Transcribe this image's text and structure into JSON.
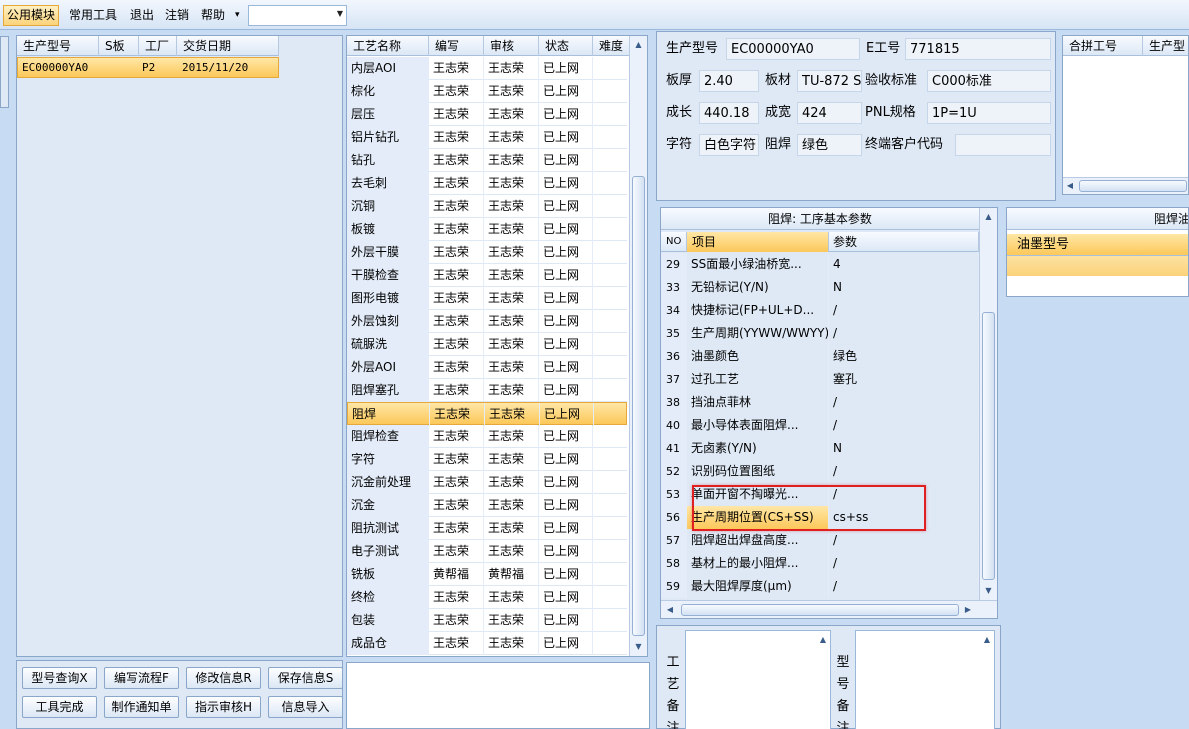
{
  "menubar": {
    "items": [
      "公用模块",
      "常用工具",
      "退出",
      "注销",
      "帮助"
    ],
    "combo_value": ""
  },
  "product_grid": {
    "headers": [
      "生产型号",
      "S板",
      "工厂",
      "交货日期"
    ],
    "rows": [
      [
        "EC00000YA0",
        "",
        "P2",
        "2015/11/20"
      ]
    ]
  },
  "process_grid": {
    "headers": [
      "工艺名称",
      "编写",
      "审核",
      "状态",
      "难度"
    ],
    "rows": [
      [
        "内层AOI",
        "王志荣",
        "王志荣",
        "已上网",
        ""
      ],
      [
        "棕化",
        "王志荣",
        "王志荣",
        "已上网",
        ""
      ],
      [
        "层压",
        "王志荣",
        "王志荣",
        "已上网",
        ""
      ],
      [
        "铝片钻孔",
        "王志荣",
        "王志荣",
        "已上网",
        ""
      ],
      [
        "钻孔",
        "王志荣",
        "王志荣",
        "已上网",
        ""
      ],
      [
        "去毛刺",
        "王志荣",
        "王志荣",
        "已上网",
        ""
      ],
      [
        "沉铜",
        "王志荣",
        "王志荣",
        "已上网",
        ""
      ],
      [
        "板镀",
        "王志荣",
        "王志荣",
        "已上网",
        ""
      ],
      [
        "外层干膜",
        "王志荣",
        "王志荣",
        "已上网",
        ""
      ],
      [
        "干膜检查",
        "王志荣",
        "王志荣",
        "已上网",
        ""
      ],
      [
        "图形电镀",
        "王志荣",
        "王志荣",
        "已上网",
        ""
      ],
      [
        "外层蚀刻",
        "王志荣",
        "王志荣",
        "已上网",
        ""
      ],
      [
        "硫脲洗",
        "王志荣",
        "王志荣",
        "已上网",
        ""
      ],
      [
        "外层AOI",
        "王志荣",
        "王志荣",
        "已上网",
        ""
      ],
      [
        "阻焊塞孔",
        "王志荣",
        "王志荣",
        "已上网",
        ""
      ],
      [
        "阻焊",
        "王志荣",
        "王志荣",
        "已上网",
        ""
      ],
      [
        "阻焊检查",
        "王志荣",
        "王志荣",
        "已上网",
        ""
      ],
      [
        "字符",
        "王志荣",
        "王志荣",
        "已上网",
        ""
      ],
      [
        "沉金前处理",
        "王志荣",
        "王志荣",
        "已上网",
        ""
      ],
      [
        "沉金",
        "王志荣",
        "王志荣",
        "已上网",
        ""
      ],
      [
        "阻抗测试",
        "王志荣",
        "王志荣",
        "已上网",
        ""
      ],
      [
        "电子测试",
        "王志荣",
        "王志荣",
        "已上网",
        ""
      ],
      [
        "铣板",
        "黄帮福",
        "黄帮福",
        "已上网",
        ""
      ],
      [
        "终检",
        "王志荣",
        "王志荣",
        "已上网",
        ""
      ],
      [
        "包装",
        "王志荣",
        "王志荣",
        "已上网",
        ""
      ],
      [
        "成品仓",
        "王志荣",
        "王志荣",
        "已上网",
        ""
      ]
    ],
    "selected_index": 15
  },
  "buttons": [
    "型号查询X",
    "编写流程F",
    "修改信息R",
    "保存信息S",
    "工具完成",
    "制作通知单",
    "指示审核H",
    "信息导入"
  ],
  "info": {
    "row1": {
      "l1": "生产型号",
      "v1": "EC00000YA0",
      "l2": "E工号",
      "v2": "771815"
    },
    "row2": {
      "l1": "板厚",
      "v1": "2.40",
      "l2": "板材",
      "v2": "TU-872 S",
      "l3": "验收标准",
      "v3": "C000标准"
    },
    "row3": {
      "l1": "成长",
      "v1": "440.18",
      "l2": "成宽",
      "v2": "424",
      "l3": "PNL规格",
      "v3": "1P=1U"
    },
    "row4": {
      "l1": "字符",
      "v1": "白色字符",
      "l2": "阻焊",
      "v2": "绿色",
      "l3": "终端客户代码",
      "v3": ""
    }
  },
  "combine_grid": {
    "headers": [
      "合拼工号",
      "生产型"
    ]
  },
  "params": {
    "title": "阻焊: 工序基本参数",
    "headers": [
      "NO",
      "项目",
      "参数"
    ],
    "rows": [
      [
        "29",
        "SS面最小绿油桥宽...",
        "4"
      ],
      [
        "33",
        "无铅标记(Y/N)",
        "N"
      ],
      [
        "34",
        "快捷标记(FP+UL+D...",
        "/"
      ],
      [
        "35",
        "生产周期(YYWW/WWYY)",
        "/"
      ],
      [
        "36",
        "油墨颜色",
        "绿色"
      ],
      [
        "37",
        "过孔工艺",
        "塞孔"
      ],
      [
        "38",
        "挡油点菲林",
        "/"
      ],
      [
        "40",
        "最小导体表面阻焊...",
        "/"
      ],
      [
        "41",
        "无卤素(Y/N)",
        "N"
      ],
      [
        "52",
        "识别码位置图纸",
        "/"
      ],
      [
        "53",
        "单面开窗不掏曝光...",
        "/"
      ],
      [
        "56",
        "生产周期位置(CS+SS)",
        "cs+ss"
      ],
      [
        "57",
        "阻焊超出焊盘高度...",
        "/"
      ],
      [
        "58",
        "基材上的最小阻焊...",
        "/"
      ],
      [
        "59",
        "最大阻焊厚度(μm)",
        "/"
      ]
    ],
    "selected_index": 11
  },
  "ink": {
    "title": "阻焊油",
    "header": "油墨型号"
  },
  "notes": {
    "process_label": "工艺备注",
    "model_label": "型号备注"
  }
}
